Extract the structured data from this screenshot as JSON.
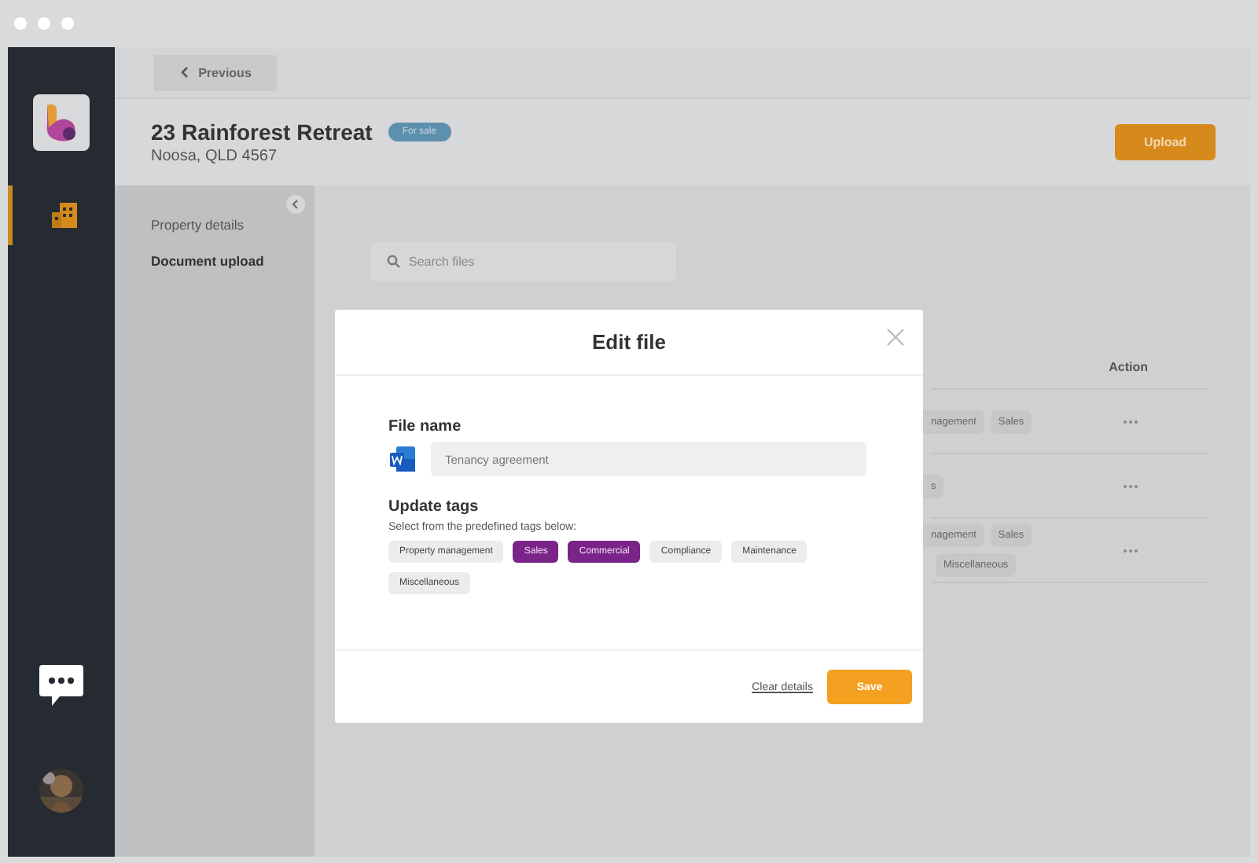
{
  "nav": {
    "items": [
      {
        "kind": "building",
        "selected": true
      }
    ]
  },
  "back_button": {
    "label": "Previous"
  },
  "property": {
    "title": "23 Rainforest Retreat",
    "address": "Noosa, QLD 4567",
    "badge": "For sale"
  },
  "upload_button": {
    "label": "Upload"
  },
  "side_menu": [
    {
      "label": "Property details",
      "selected": false
    },
    {
      "label": "Document upload",
      "selected": true
    }
  ],
  "search": {
    "placeholder": "Search files"
  },
  "table": {
    "columns": [
      "Action"
    ],
    "rows": [
      {
        "tags": [
          [
            "nagement",
            "Sales"
          ]
        ]
      },
      {
        "tags": [
          [
            "s"
          ]
        ]
      },
      {
        "tags": [
          [
            "nagement",
            "Sales"
          ],
          [
            "Miscellaneous"
          ]
        ]
      }
    ]
  },
  "modal": {
    "title": "Edit file",
    "file_label": "File name",
    "file_value": "Tenancy agreement",
    "tags_label": "Update tags",
    "tags_hint": "Select from the predefined tags below:",
    "tags": [
      {
        "label": "Property management",
        "selected": false
      },
      {
        "label": "Sales",
        "selected": true
      },
      {
        "label": "Commercial",
        "selected": true
      },
      {
        "label": "Compliance",
        "selected": false
      },
      {
        "label": "Maintenance",
        "selected": false
      },
      {
        "label": "Miscellaneous",
        "selected": false
      }
    ],
    "clear_link": "Clear details",
    "save_button": "Save"
  }
}
